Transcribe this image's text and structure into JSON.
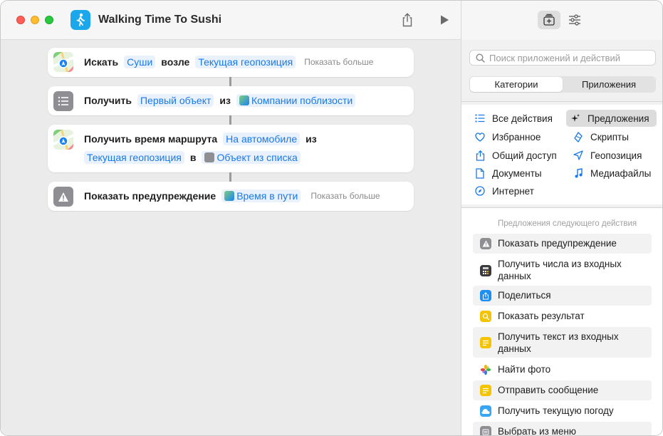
{
  "window": {
    "title": "Walking Time To Sushi"
  },
  "actions": [
    {
      "name": "search",
      "line1": [
        {
          "kind": "word",
          "text": "Искать"
        },
        {
          "kind": "token",
          "text": "Суши"
        },
        {
          "kind": "word",
          "text": "возле"
        },
        {
          "kind": "token",
          "text": "Текущая геопозиция"
        },
        {
          "kind": "more",
          "text": "Показать больше"
        }
      ]
    },
    {
      "name": "get-item",
      "line1": [
        {
          "kind": "word",
          "text": "Получить"
        },
        {
          "kind": "token",
          "text": "Первый объект"
        },
        {
          "kind": "word",
          "text": "из"
        },
        {
          "kind": "token-icon",
          "text": "Компании поблизости"
        }
      ]
    },
    {
      "name": "travel-time",
      "line1": [
        {
          "kind": "word",
          "text": "Получить время маршрута"
        },
        {
          "kind": "token",
          "text": "На автомобиле"
        },
        {
          "kind": "word",
          "text": "из"
        }
      ],
      "line2": [
        {
          "kind": "token",
          "text": "Текущая геопозиция"
        },
        {
          "kind": "word",
          "text": "в"
        },
        {
          "kind": "token-icon",
          "text": "Объект из списка"
        }
      ]
    },
    {
      "name": "show-alert",
      "line1": [
        {
          "kind": "word",
          "text": "Показать предупреждение"
        },
        {
          "kind": "token-icon",
          "text": "Время в пути"
        },
        {
          "kind": "more",
          "text": "Показать больше"
        }
      ]
    }
  ],
  "sidebar": {
    "search_placeholder": "Поиск приложений и действий",
    "segments": [
      "Категории",
      "Приложения"
    ],
    "active_segment": "Категории",
    "categories_left": [
      {
        "label": "Все действия",
        "icon": "list-icon"
      },
      {
        "label": "Избранное",
        "icon": "heart-icon"
      },
      {
        "label": "Общий доступ",
        "icon": "share-icon"
      },
      {
        "label": "Документы",
        "icon": "document-icon"
      },
      {
        "label": "Интернет",
        "icon": "compass-icon"
      }
    ],
    "categories_right": [
      {
        "label": "Предложения",
        "icon": "sparkles-icon"
      },
      {
        "label": "Скрипты",
        "icon": "script-icon"
      },
      {
        "label": "Геопозиция",
        "icon": "location-icon"
      },
      {
        "label": "Медиафайлы",
        "icon": "music-note-icon"
      }
    ],
    "active_category": "Предложения",
    "suggestions_header": "Предложения следующего действия",
    "suggestions": [
      {
        "label": "Показать предупреждение",
        "icon": "alert-icon",
        "color": "#8e8e93"
      },
      {
        "label": "Получить числа из входных данных",
        "icon": "calculator-icon",
        "color": "#3a3a3c"
      },
      {
        "label": "Поделиться",
        "icon": "share-icon",
        "color": "#1e8ef0"
      },
      {
        "label": "Показать результат",
        "icon": "quick-look-icon",
        "color": "#f5c400"
      },
      {
        "label": "Получить текст из входных данных",
        "icon": "text-icon",
        "color": "#f5c400"
      },
      {
        "label": "Найти фото",
        "icon": "photos-icon",
        "color": "#ffffff"
      },
      {
        "label": "Отправить сообщение",
        "icon": "message-icon",
        "color": "#f5c400"
      },
      {
        "label": "Получить текущую погоду",
        "icon": "weather-icon",
        "color": "#3aa6f3"
      },
      {
        "label": "Выбрать из меню",
        "icon": "menu-icon",
        "color": "#8e8e93"
      }
    ]
  }
}
